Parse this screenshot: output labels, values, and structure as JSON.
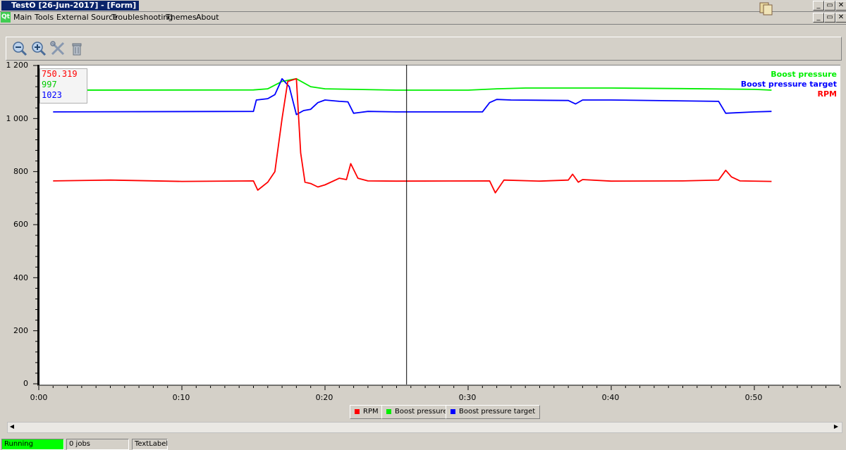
{
  "window": {
    "title": "TestO [26-Jun-2017] - [Form]"
  },
  "menu": {
    "logo": "Qt",
    "items": [
      "Main",
      "Tools",
      "External Source",
      "Troubleshooting",
      "Themes",
      "About"
    ]
  },
  "toolbar": {
    "icons": [
      "zoom-out-icon",
      "zoom-in-icon",
      "tools-icon",
      "trash-icon"
    ]
  },
  "readout": {
    "rpm": "750.319",
    "boost": "997",
    "target": "1023"
  },
  "legend": {
    "rpm": "RPM",
    "boost": "Boost pressure",
    "target": "Boost pressure target"
  },
  "status": {
    "state": "Running",
    "jobs": "0 jobs",
    "label": "TextLabel"
  },
  "colors": {
    "rpm": "#ff0000",
    "boost": "#00ee00",
    "target": "#0000ff",
    "running": "#00ff00"
  },
  "chart_data": {
    "type": "line",
    "xlabel": "",
    "ylabel": "",
    "ylim": [
      0,
      1200
    ],
    "xlim": [
      0,
      56.5
    ],
    "yticks": [
      "1 200",
      "1 000",
      "800",
      "600",
      "400",
      "200",
      "0"
    ],
    "xticks": [
      "0:00",
      "0:10",
      "0:20",
      "0:30",
      "0:40",
      "0:50"
    ],
    "cursor_x": 25.7,
    "series": [
      {
        "name": "Boost pressure",
        "x": [
          1,
          15,
          16,
          17,
          18,
          19,
          20,
          25,
          30,
          32,
          34,
          40,
          45,
          50,
          51.2
        ],
        "y": [
          1107,
          1108,
          1112,
          1140,
          1150,
          1120,
          1112,
          1107,
          1107,
          1112,
          1115,
          1115,
          1113,
          1110,
          1107
        ]
      },
      {
        "name": "Boost pressure target",
        "x": [
          1,
          15,
          15.2,
          16,
          16.5,
          17,
          17.5,
          18,
          18.5,
          19,
          19.5,
          20,
          21,
          21.6,
          22,
          23,
          25,
          31,
          31.5,
          32,
          33,
          37,
          37.5,
          38,
          40,
          47.5,
          48,
          50,
          51.2
        ],
        "y": [
          1025,
          1027,
          1070,
          1075,
          1090,
          1150,
          1120,
          1015,
          1030,
          1035,
          1060,
          1070,
          1065,
          1063,
          1020,
          1027,
          1025,
          1025,
          1060,
          1072,
          1070,
          1068,
          1055,
          1070,
          1070,
          1065,
          1020,
          1025,
          1027
        ]
      },
      {
        "name": "RPM",
        "x": [
          1,
          5,
          10,
          15,
          15.3,
          16,
          16.5,
          17,
          17.4,
          18,
          18.3,
          18.6,
          19,
          19.5,
          20,
          21,
          21.5,
          21.8,
          22.3,
          23,
          25,
          31.5,
          31.9,
          32.5,
          35,
          37,
          37.3,
          37.7,
          38,
          40,
          45,
          47.5,
          48,
          48.4,
          49,
          51.2
        ],
        "y": [
          765,
          768,
          763,
          765,
          730,
          760,
          800,
          1000,
          1140,
          1150,
          870,
          760,
          755,
          742,
          750,
          775,
          770,
          830,
          775,
          765,
          764,
          765,
          720,
          768,
          764,
          768,
          790,
          760,
          770,
          764,
          765,
          768,
          805,
          780,
          765,
          763
        ]
      }
    ]
  }
}
